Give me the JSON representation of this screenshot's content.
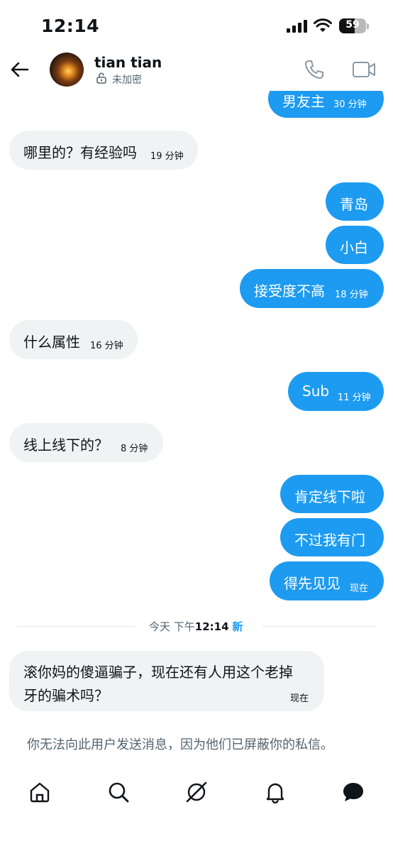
{
  "status_bar": {
    "time": "12:14",
    "battery": "59",
    "battery_level": 0.59
  },
  "header": {
    "contact_name": "tian tian",
    "encryption_label": "未加密"
  },
  "messages": [
    {
      "dir": "out",
      "text": "男友主",
      "time": "30 分钟"
    },
    {
      "dir": "in",
      "text": "哪里的？有经验吗",
      "time": "19 分钟"
    },
    {
      "dir": "out",
      "text": "青岛",
      "time": ""
    },
    {
      "dir": "out",
      "text": "小白",
      "time": ""
    },
    {
      "dir": "out",
      "text": "接受度不高",
      "time": "18 分钟"
    },
    {
      "dir": "in",
      "text": "什么属性",
      "time": "16 分钟"
    },
    {
      "dir": "out",
      "text": "Sub",
      "time": "11 分钟"
    },
    {
      "dir": "in",
      "text": "线上线下的？",
      "time": "8 分钟"
    },
    {
      "dir": "out",
      "text": "肯定线下啦",
      "time": ""
    },
    {
      "dir": "out",
      "text": "不过我有门",
      "time": ""
    },
    {
      "dir": "out",
      "text": "得先见见",
      "time": "现在"
    },
    {
      "dir": "in",
      "text_line1": "滚你妈的傻逼骗子，现在还有人用这个老掉",
      "text_line2": "牙的骗术吗？",
      "time": "现在"
    }
  ],
  "divider": {
    "prefix": "今天 下午",
    "time": "12:14",
    "new_label": "新"
  },
  "notice": "你无法向此用户发送消息，因为他们已屏蔽你的私信。",
  "colors": {
    "accent": "#1d9bf0",
    "incoming_bubble": "#eff3f4",
    "secondary_text": "#536471"
  },
  "nav": {
    "icons": [
      "home-icon",
      "search-icon",
      "grok-icon",
      "notifications-icon",
      "messages-icon"
    ]
  }
}
